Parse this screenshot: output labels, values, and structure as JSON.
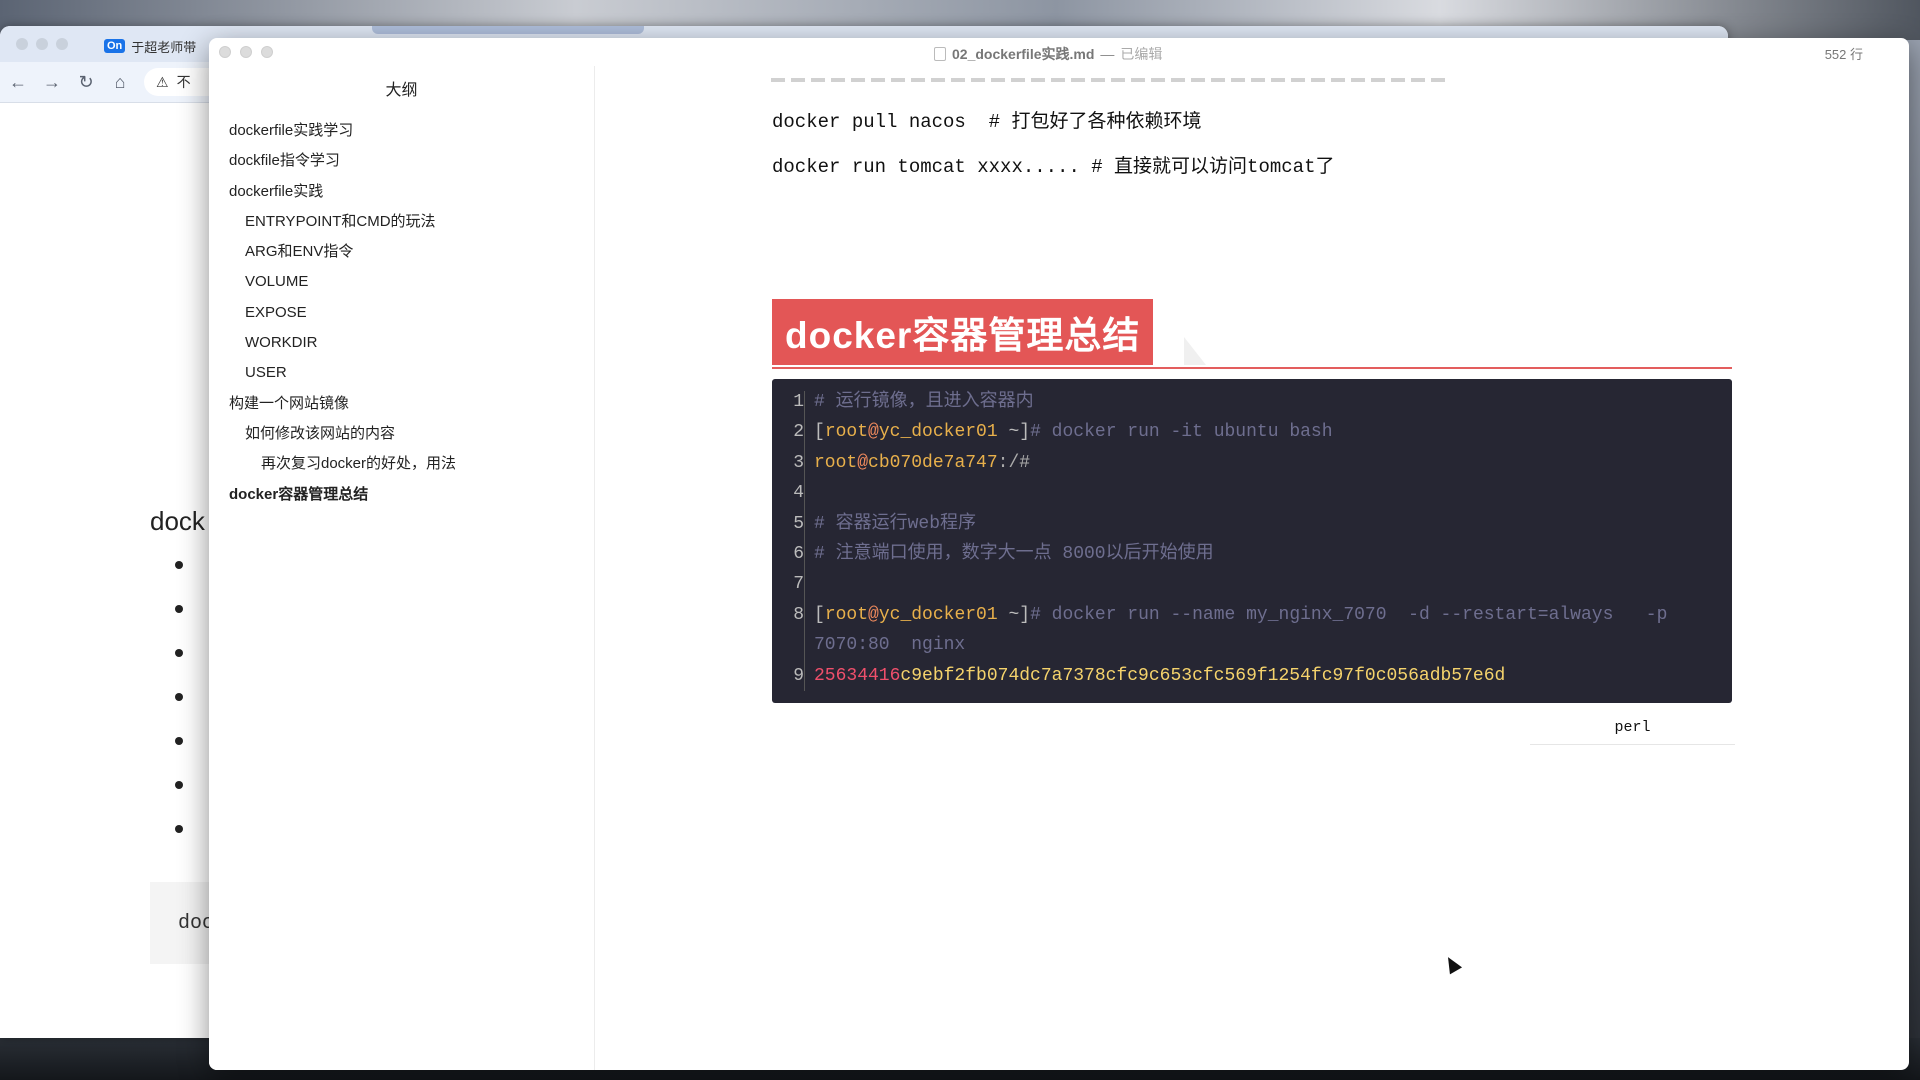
{
  "browser": {
    "tab_label": "于超老师带",
    "tab_badge": "On",
    "address_text": "不",
    "bg_heading": "dock",
    "bg_code": "doc"
  },
  "editor": {
    "file_name": "02_dockerfile实践.md",
    "dash": "—",
    "status": "已编辑",
    "line_count": "552 行"
  },
  "sidebar": {
    "title": "大纲",
    "items": [
      {
        "label": "dockerfile实践学习",
        "level": 1
      },
      {
        "label": "dockfile指令学习",
        "level": 1
      },
      {
        "label": "dockerfile实践",
        "level": 1
      },
      {
        "label": "ENTRYPOINT和CMD的玩法",
        "level": 2
      },
      {
        "label": "ARG和ENV指令",
        "level": 2
      },
      {
        "label": "VOLUME",
        "level": 2
      },
      {
        "label": "EXPOSE",
        "level": 2
      },
      {
        "label": "WORKDIR",
        "level": 2
      },
      {
        "label": "USER",
        "level": 2
      },
      {
        "label": "构建一个网站镜像",
        "level": 1
      },
      {
        "label": "如何修改该网站的内容",
        "level": 2
      },
      {
        "label": "再次复习docker的好处，用法",
        "level": 3
      },
      {
        "label": "docker容器管理总结",
        "level": 1,
        "active": true
      }
    ]
  },
  "content": {
    "line1": "docker pull nacos  # 打包好了各种依赖环境",
    "line2": "docker run tomcat xxxx..... # 直接就可以访问tomcat了",
    "heading": "docker容器管理总结",
    "code_lang": "perl",
    "code_line_numbers": [
      "1",
      "2",
      "3",
      "4",
      "5",
      "6",
      "7",
      "8",
      "",
      "9"
    ],
    "code": {
      "l1": "# 运行镜像，且进入容器内",
      "l2_open": "[",
      "l2_user": "root",
      "l2_at": "@",
      "l2_host": "yc_docker01",
      "l2_rest": " ~]",
      "l2_cmd": "# docker run -it ubuntu bash",
      "l3_user": "root",
      "l3_at": "@",
      "l3_host": "cb070de7a747",
      "l3_rest": ":/#",
      "l5": "# 容器运行web程序",
      "l6": "# 注意端口使用，数字大一点 8000以后开始使用",
      "l8_open": "[",
      "l8_user": "root",
      "l8_at": "@",
      "l8_host": "yc_docker01",
      "l8_rest": " ~]",
      "l8_cmd": "# docker run --name my_nginx_7070  -d --restart=always   -p",
      "l8_cont": "7070:80  nginx",
      "l9_red": "25634416",
      "l9_hex": "c9ebf2fb074dc7a7378cfc9c653cfc569f1254fc97f0c056adb57e6d"
    }
  }
}
